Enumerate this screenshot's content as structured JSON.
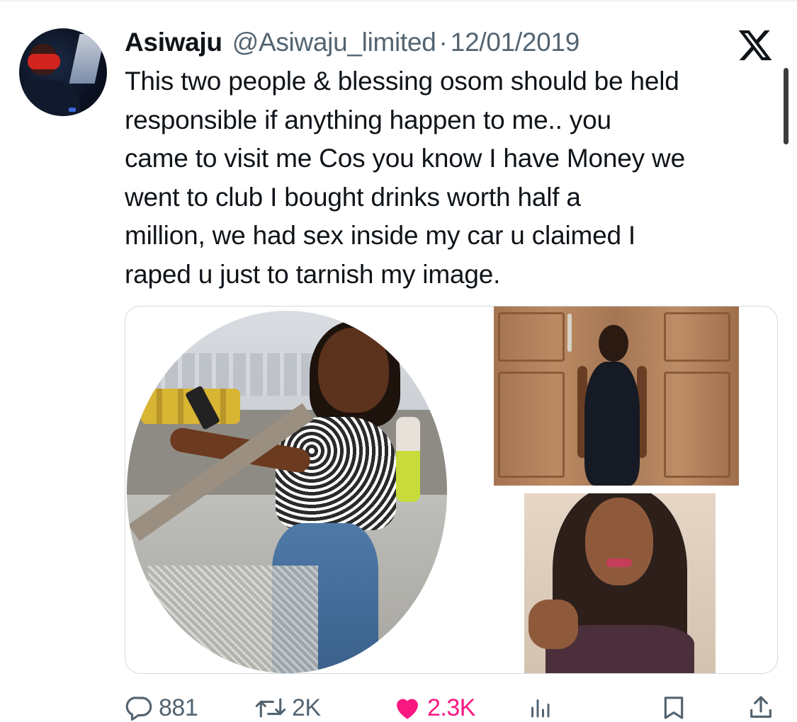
{
  "post": {
    "author_name": "Asiwaju",
    "author_handle": "@Asiwaju_limited",
    "separator": "·",
    "date": "12/01/2019",
    "text_lines": [
      "This two people & blessing osom should be held",
      "responsible if anything happen to me.. you",
      "came to visit me Cos you know I have Money we",
      "went to club  I bought drinks worth half a",
      "million, we had sex inside my car u claimed I",
      "raped u just to tarnish my image."
    ]
  },
  "brand": {
    "logo_icon": "x-logo-icon"
  },
  "media": {
    "images": [
      {
        "icon": "photo-circle-crop"
      },
      {
        "icon": "photo-door"
      },
      {
        "icon": "photo-portrait"
      }
    ]
  },
  "actions": {
    "reply_count": "881",
    "retweet_count": "2K",
    "like_count": "2.3K",
    "views_icon": "views-icon",
    "bookmark_icon": "bookmark-icon",
    "share_icon": "share-icon"
  },
  "colors": {
    "text_primary": "#0f1419",
    "text_secondary": "#536471",
    "like_pink": "#f91880",
    "border": "#cfd9de"
  }
}
